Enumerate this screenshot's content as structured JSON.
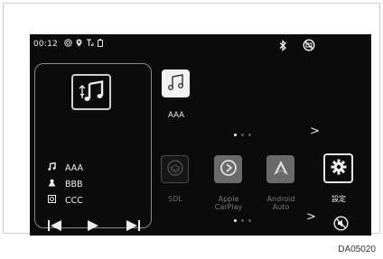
{
  "status_bar": {
    "time": "00:12",
    "icons": [
      "wifi-icon",
      "location-icon",
      "signal-icon",
      "battery-icon",
      "bluetooth-icon",
      "mute-icon"
    ]
  },
  "media": {
    "source_icon": "usb-music-icon",
    "title": "AAA",
    "artist": "BBB",
    "album": "CCC",
    "controls": [
      "previous-track",
      "play",
      "next-track"
    ]
  },
  "apps_top": [
    {
      "name": "music-app",
      "label": "AAA"
    }
  ],
  "apps_bottom": [
    {
      "name": "sdl-app",
      "label": "SDL"
    },
    {
      "name": "apple-carplay-app",
      "label": "Apple CarPlay"
    },
    {
      "name": "android-auto-app",
      "label": "Android Auto"
    },
    {
      "name": "settings-app",
      "label": "設定"
    }
  ],
  "pagination": {
    "pages": 3,
    "current": 1
  },
  "colors": {
    "background": "#0b0b0b",
    "disabled_tile": "#6a6a6a",
    "text": "#f0f0f0"
  },
  "figure_id": "DA05020"
}
